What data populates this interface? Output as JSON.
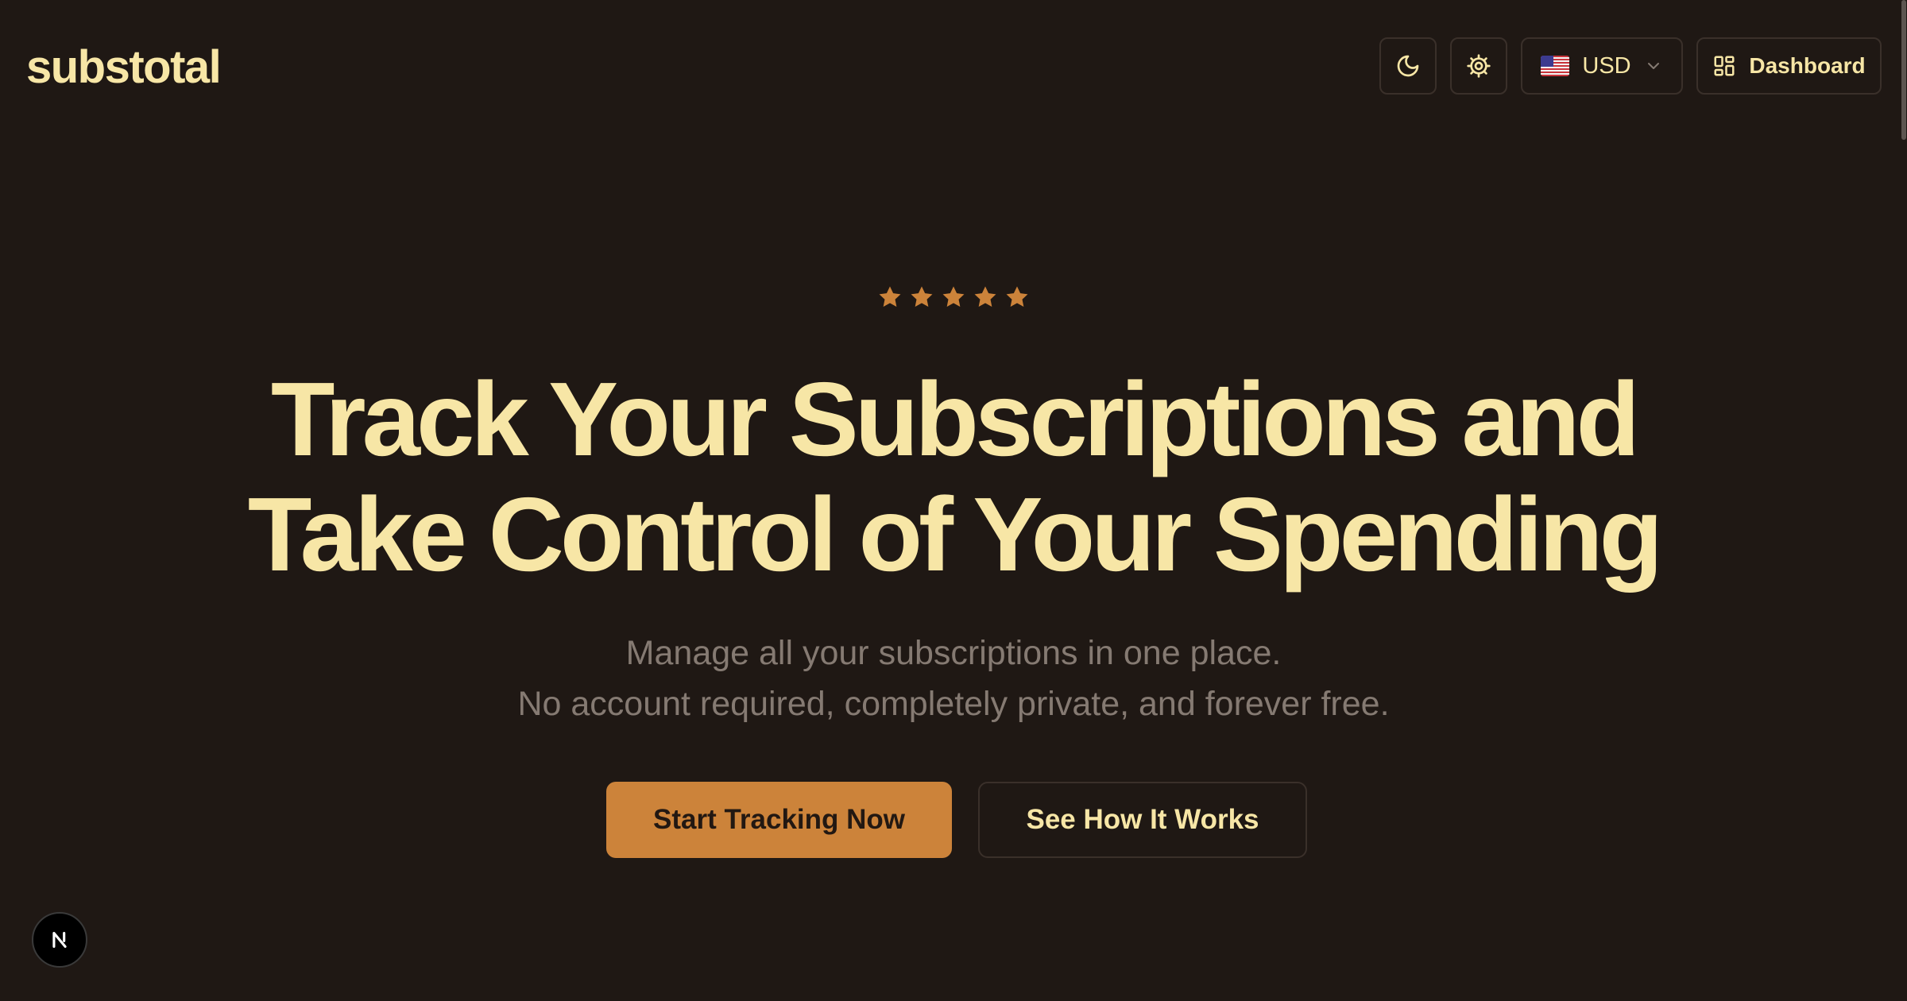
{
  "header": {
    "logo": "substotal",
    "currency": {
      "code": "USD",
      "flag": "us-flag-icon"
    },
    "dashboard_label": "Dashboard",
    "icons": {
      "theme_toggle": "moon-icon",
      "settings": "gear-icon",
      "currency_dropdown": "chevron-down-icon",
      "dashboard": "grid-icon"
    }
  },
  "hero": {
    "rating": {
      "stars": 5,
      "icon": "star-icon"
    },
    "title_line1": "Track Your Subscriptions and",
    "title_line2": "Take Control of Your Spending",
    "subtitle_line1": "Manage all your subscriptions in one place.",
    "subtitle_line2": "No account required, completely private, and forever free.",
    "primary_cta": "Start Tracking Now",
    "secondary_cta": "See How It Works"
  },
  "dev_badge": {
    "label": "N",
    "icon": "nextjs-icon"
  },
  "colors": {
    "background": "#1f1814",
    "text_primary": "#f7e6a6",
    "text_muted": "#857a72",
    "accent": "#cc833a",
    "border": "#3a302a"
  }
}
